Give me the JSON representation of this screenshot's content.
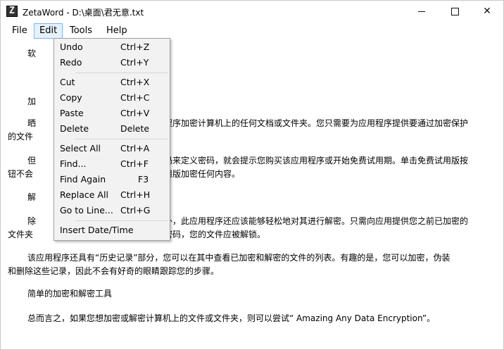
{
  "window": {
    "title": "ZetaWord - D:\\桌面\\君无意.txt",
    "icon": "zetaword-app-icon",
    "minimize": "minimize-icon",
    "maximize": "maximize-icon",
    "close": "✕"
  },
  "menubar": {
    "file": "File",
    "edit": "Edit",
    "tools": "Tools",
    "help": "Help"
  },
  "edit_menu": {
    "undo": {
      "label": "Undo",
      "shortcut": "Ctrl+Z"
    },
    "redo": {
      "label": "Redo",
      "shortcut": "Ctrl+Y"
    },
    "cut": {
      "label": "Cut",
      "shortcut": "Ctrl+X"
    },
    "copy": {
      "label": "Copy",
      "shortcut": "Ctrl+C"
    },
    "paste": {
      "label": "Paste",
      "shortcut": "Ctrl+V"
    },
    "delete": {
      "label": "Delete",
      "shortcut": "Delete"
    },
    "select_all": {
      "label": "Select All",
      "shortcut": "Ctrl+A"
    },
    "find": {
      "label": "Find...",
      "shortcut": "Ctrl+F"
    },
    "find_again": {
      "label": "Find Again",
      "shortcut": "F3"
    },
    "replace_all": {
      "label": "Replace All",
      "shortcut": "Ctrl+H"
    },
    "goto_line": {
      "label": "Go to Line...",
      "shortcut": "Ctrl+G"
    },
    "insert_datetime": {
      "label": "Insert Date/Time",
      "shortcut": ""
    }
  },
  "document": {
    "p1": "软",
    "p2": "加",
    "p3": "　　　　　　　　　　　　　　　　　　　程序加密计算机上的任何文档或文件夹。您只需要为应用程序提供要通过加密保护",
    "p3b": "的文件",
    "p4": "　　　　　　　　　　　　　　　　　　码来定义密码，就会提示您购买该应用程序或开始免费试用期。单击免费试用版按",
    "p4b": "钮不会　　　　　　　　　　　　　　　　　用版加密任何内容。",
    "p5": "解",
    "p6": "　　　　　　　　　　　　　　　　　　外，此应用程序还应该能够轻松地对其进行解密。只需向应用提供您之前已加密的",
    "p6b": "文件夹　　　　　　　　　　　　　　　　密码，您的文件应被解锁。",
    "p7": "该应用程序还具有“历史记录”部分，您可以在其中查看已加密和解密的文件的列表。有趣的是，您可以加密，伪装",
    "p7b": "和删除这些记录，因此不会有好奇的眼睛跟踪您的步骤。",
    "p8": "简单的加密和解密工具",
    "p9": "总而言之，如果您想加密或解密计算机上的文件或文件夹，则可以尝试“ Amazing Any Data Encryption”。",
    "prefix_p3": "晒",
    "prefix_p4": "但",
    "prefix_p6": "除"
  }
}
